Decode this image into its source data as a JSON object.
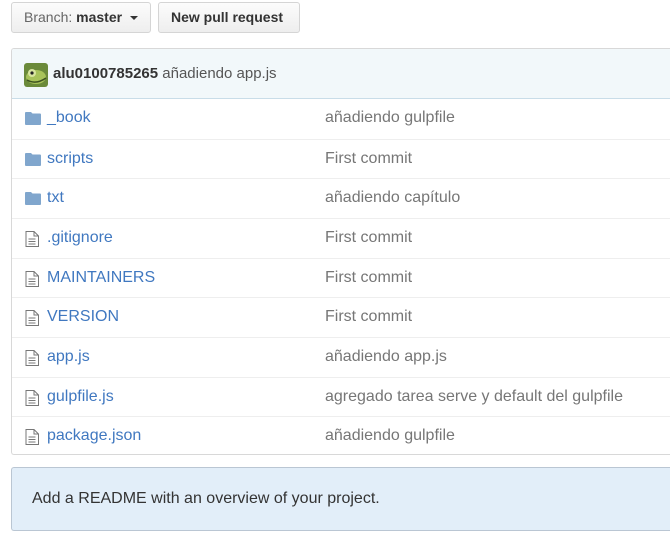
{
  "branch": {
    "prefix": "Branch:",
    "name": "master"
  },
  "new_pr_label": "New pull request",
  "latest_commit": {
    "author": "alu0100785265",
    "message": "añadiendo app.js"
  },
  "files": [
    {
      "type": "folder",
      "icon": "folder-icon",
      "name": "_book",
      "commit": "añadiendo gulpfile"
    },
    {
      "type": "folder",
      "icon": "folder-icon",
      "name": "scripts",
      "commit": "First commit"
    },
    {
      "type": "folder",
      "icon": "folder-icon",
      "name": "txt",
      "commit": "añadiendo capítulo"
    },
    {
      "type": "file",
      "icon": "file-icon",
      "name": ".gitignore",
      "commit": "First commit"
    },
    {
      "type": "file",
      "icon": "file-icon",
      "name": "MAINTAINERS",
      "commit": "First commit"
    },
    {
      "type": "file",
      "icon": "file-icon",
      "name": "VERSION",
      "commit": "First commit"
    },
    {
      "type": "file",
      "icon": "file-icon",
      "name": "app.js",
      "commit": "añadiendo app.js"
    },
    {
      "type": "file",
      "icon": "file-icon",
      "name": "gulpfile.js",
      "commit": "agregado tarea serve y default del gulpfile"
    },
    {
      "type": "file",
      "icon": "file-icon",
      "name": "package.json",
      "commit": "añadiendo gulpfile"
    }
  ],
  "readme_prompt": "Add a README with an overview of your project.",
  "colors": {
    "link": "#4078c0",
    "folder": "#80a6cd",
    "file": "#777777",
    "commit_bar": "#f2f8fa",
    "readme_bg": "#e2eef9"
  }
}
